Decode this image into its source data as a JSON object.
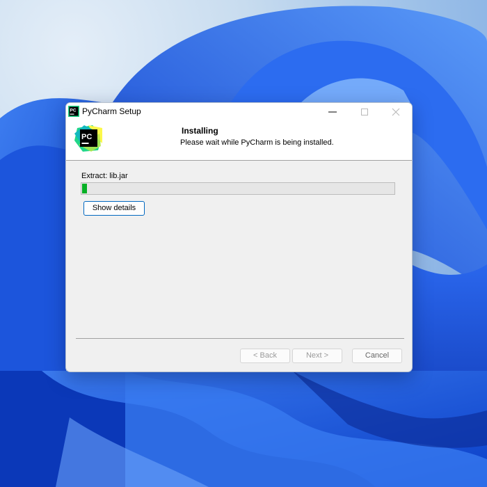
{
  "window": {
    "title": "PyCharm Setup",
    "app_icon": "pycharm-icon",
    "controls": [
      "minimize-icon",
      "maximize-icon",
      "close-icon"
    ]
  },
  "header": {
    "title": "Installing",
    "subtitle": "Please wait while PyCharm is being installed.",
    "logo_text": "PC"
  },
  "progress": {
    "status": "Extract: lib.jar",
    "value_percent": 1.5,
    "color": "#06b025"
  },
  "buttons": {
    "show_details": "Show details",
    "back": "< Back",
    "next": "Next >",
    "cancel": "Cancel"
  },
  "colors": {
    "accent": "#0067c0"
  }
}
